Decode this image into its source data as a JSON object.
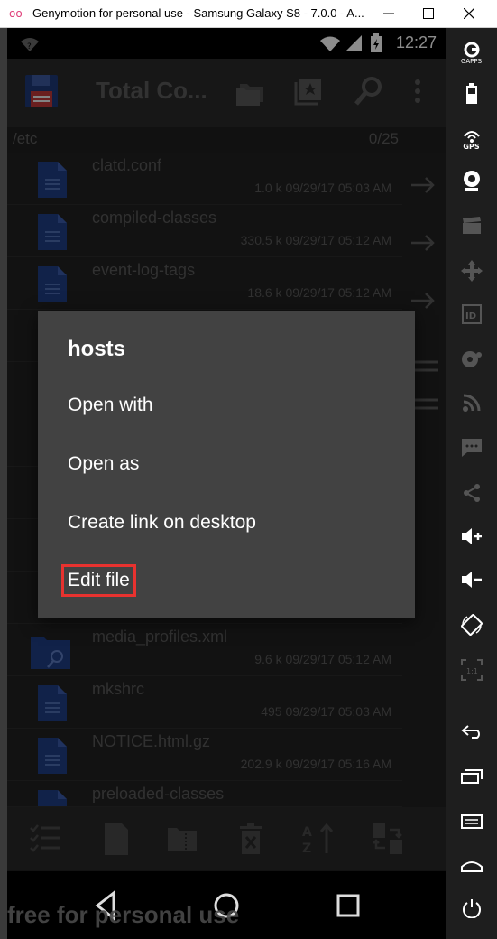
{
  "window": {
    "title": "Genymotion for personal use - Samsung Galaxy S8 - 7.0.0 - A...",
    "logo": "oo",
    "minimize_icon": "minimize-icon",
    "maximize_icon": "maximize-icon",
    "close_icon": "close-icon"
  },
  "status_bar": {
    "time": "12:27"
  },
  "app_bar": {
    "title": "Total Co..."
  },
  "path_bar": {
    "path": "/etc",
    "count": "0/25"
  },
  "files": [
    {
      "name": "clatd.conf",
      "meta": "1.0 k  09/29/17  05:03 AM",
      "icon": "document-icon"
    },
    {
      "name": "compiled-classes",
      "meta": "330.5 k  09/29/17  05:12 AM",
      "icon": "document-icon"
    },
    {
      "name": "event-log-tags",
      "meta": "18.6 k  09/29/17  05:12 AM",
      "icon": "document-icon"
    },
    {
      "name": "media_profiles.xml",
      "meta": "9.6 k  09/29/17  05:12 AM",
      "icon": "xml-document-icon"
    },
    {
      "name": "mkshrc",
      "meta": "495  09/29/17  05:03 AM",
      "icon": "document-icon"
    },
    {
      "name": "NOTICE.html.gz",
      "meta": "202.9 k  09/29/17  05:16 AM",
      "icon": "document-icon"
    },
    {
      "name": "preloaded-classes",
      "meta": "",
      "icon": "document-icon"
    }
  ],
  "dialog": {
    "title": "hosts",
    "items": [
      "Open with",
      "Open as",
      "Create link on desktop",
      "Edit file"
    ]
  },
  "watermark": "free for personal use",
  "colors": {
    "accent_highlight": "#e8322f",
    "file_icon_blue": "#1f3f86",
    "dialog_bg": "#424242"
  },
  "right_panel_labels": {
    "gapps": "GAPPS",
    "gps": "GPS",
    "rotate_label": "1:1"
  }
}
